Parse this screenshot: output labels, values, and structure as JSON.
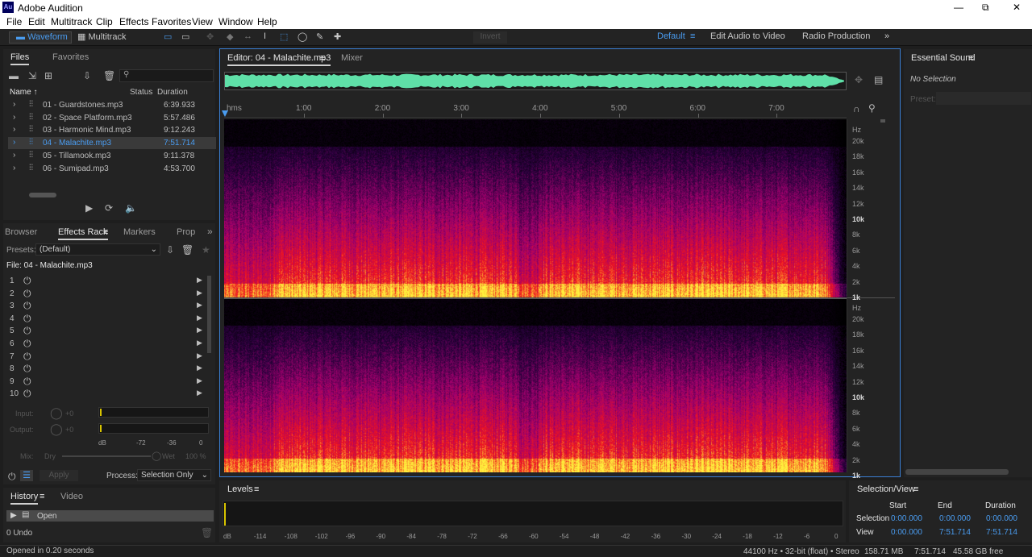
{
  "app": {
    "title": "Adobe Audition",
    "logo": "Au",
    "window_controls": [
      "—",
      "⧉",
      "✕"
    ]
  },
  "menu": [
    "File",
    "Edit",
    "Multitrack",
    "Clip",
    "Effects",
    "Favorites",
    "View",
    "Window",
    "Help"
  ],
  "toolbar": {
    "waveform": "Waveform",
    "multitrack": "Multitrack",
    "invert": "Invert",
    "workspaces": [
      "Default",
      "Edit Audio to Video",
      "Radio Production"
    ]
  },
  "files_panel": {
    "tabs": [
      "Files",
      "Favorites"
    ],
    "columns": [
      "Name",
      "Status",
      "Duration"
    ],
    "search_placeholder": "",
    "files": [
      {
        "name": "01 - Guardstones.mp3",
        "duration": "6:39.933"
      },
      {
        "name": "02 - Space Platform.mp3",
        "duration": "5:57.486"
      },
      {
        "name": "03 - Harmonic Mind.mp3",
        "duration": "9:12.243"
      },
      {
        "name": "04 - Malachite.mp3",
        "duration": "7:51.714"
      },
      {
        "name": "05 - Tillamook.mp3",
        "duration": "9:11.378"
      },
      {
        "name": "06 - Sumipad.mp3",
        "duration": "4:53.700"
      }
    ],
    "selected_index": 3
  },
  "effects_panel": {
    "tabs": [
      "Browser",
      "Effects Rack",
      "Markers",
      "Prop"
    ],
    "presets_label": "Presets:",
    "preset_value": "(Default)",
    "file_label": "File: 04 - Malachite.mp3",
    "slots": [
      "1",
      "2",
      "3",
      "4",
      "5",
      "6",
      "7",
      "8",
      "9",
      "10"
    ],
    "input_label": "Input:",
    "output_label": "Output:",
    "input_value": "+0",
    "output_value": "+0",
    "meter_ticks": [
      "dB",
      "-72",
      "-36",
      "0"
    ],
    "mix_label": "Mix:",
    "dry_label": "Dry",
    "wet_label": "Wet",
    "wet_value": "100 %",
    "apply_label": "Apply",
    "process_label": "Process:",
    "process_value": "Selection Only"
  },
  "history_panel": {
    "tabs": [
      "History",
      "Video"
    ],
    "items": [
      "Open"
    ],
    "undo_count": "0 Undo"
  },
  "status_left": "Opened in 0.20 seconds",
  "editor": {
    "tab_label": "Editor: 04 - Malachite.mp3",
    "mixer_label": "Mixer",
    "time_unit": "hms",
    "time_ticks": [
      "1:00",
      "2:00",
      "3:00",
      "4:00",
      "5:00",
      "6:00",
      "7:00"
    ],
    "hz_unit": "Hz",
    "hz_ticks": [
      "20k",
      "18k",
      "16k",
      "14k",
      "12k",
      "10k",
      "8k",
      "6k",
      "4k",
      "2k",
      "1k"
    ],
    "bold_hz": [
      "10k",
      "1k"
    ]
  },
  "essential_sound": {
    "title": "Essential Sound",
    "no_selection": "No Selection",
    "preset_label": "Preset:"
  },
  "levels_panel": {
    "title": "Levels",
    "db_ticks": [
      "dB",
      "-114",
      "-108",
      "-102",
      "-96",
      "-90",
      "-84",
      "-78",
      "-72",
      "-66",
      "-60",
      "-54",
      "-48",
      "-42",
      "-36",
      "-30",
      "-24",
      "-18",
      "-12",
      "-6",
      "0"
    ]
  },
  "selection_view": {
    "title": "Selection/View",
    "columns": [
      "Start",
      "End",
      "Duration"
    ],
    "selection": {
      "label": "Selection",
      "start": "0:00.000",
      "end": "0:00.000",
      "duration": "0:00.000"
    },
    "view": {
      "label": "View",
      "start": "0:00.000",
      "end": "7:51.714",
      "duration": "7:51.714"
    }
  },
  "status_right": {
    "format": "44100 Hz • 32-bit (float) • Stereo",
    "size": "158.71 MB",
    "duration": "7:51.714",
    "free": "45.58 GB free"
  }
}
